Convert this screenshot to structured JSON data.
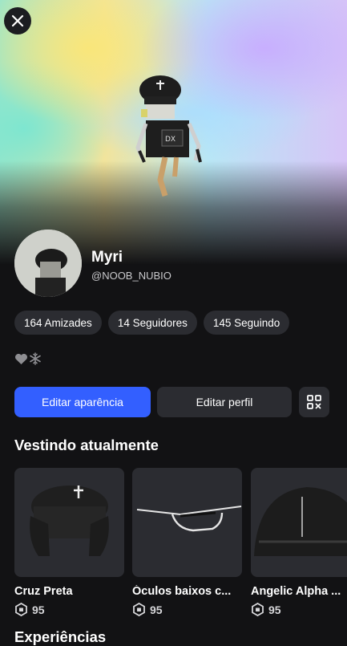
{
  "profile": {
    "display_name": "Myri",
    "username": "@NOOB_NUBIO"
  },
  "stats": [
    {
      "label": "164 Amizades"
    },
    {
      "label": "14 Seguidores"
    },
    {
      "label": "145 Seguindo"
    }
  ],
  "bio_icons": [
    "heart-icon",
    "snowflake-icon"
  ],
  "actions": {
    "edit_appearance": "Editar aparência",
    "edit_profile": "Editar perfil",
    "qr_icon": "qr-code-icon"
  },
  "wearing": {
    "title": "Vestindo atualmente",
    "items": [
      {
        "name": "Cruz Preta",
        "price": "95"
      },
      {
        "name": "Óculos baixos c...",
        "price": "95"
      },
      {
        "name": "Angelic Alpha ...",
        "price": "95"
      }
    ]
  },
  "experiences": {
    "title": "Experiências"
  },
  "colors": {
    "accent": "#335fff",
    "background": "#121214",
    "pill": "#2b2c31"
  }
}
